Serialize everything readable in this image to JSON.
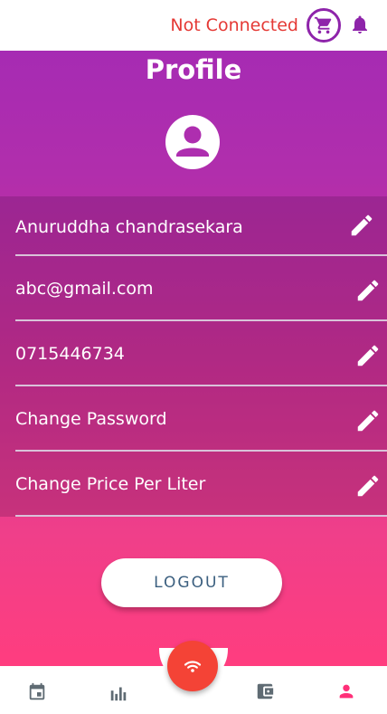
{
  "header": {
    "connection_status": "Not Connected",
    "icons": [
      "shopping-cart-icon",
      "bell-icon"
    ],
    "status_color": "#e53935",
    "accent_color": "#8e24aa"
  },
  "profile": {
    "title": "Profile",
    "fields": [
      {
        "label": "Anuruddha chandrasekara",
        "icon": "edit-icon"
      },
      {
        "label": "abc@gmail.com",
        "icon": "edit-icon"
      },
      {
        "label": "0715446734",
        "icon": "edit-icon"
      },
      {
        "label": "Change Password",
        "icon": "edit-icon"
      },
      {
        "label": "Change Price Per Liter",
        "icon": "edit-icon"
      }
    ],
    "logout_label": "LOGOUT"
  },
  "bottom_nav": {
    "items": [
      "calendar-icon",
      "bar-chart-icon",
      "wifi-icon",
      "wallet-icon",
      "person-icon"
    ],
    "active_item": "person-icon",
    "active_color": "#ff2f78"
  }
}
